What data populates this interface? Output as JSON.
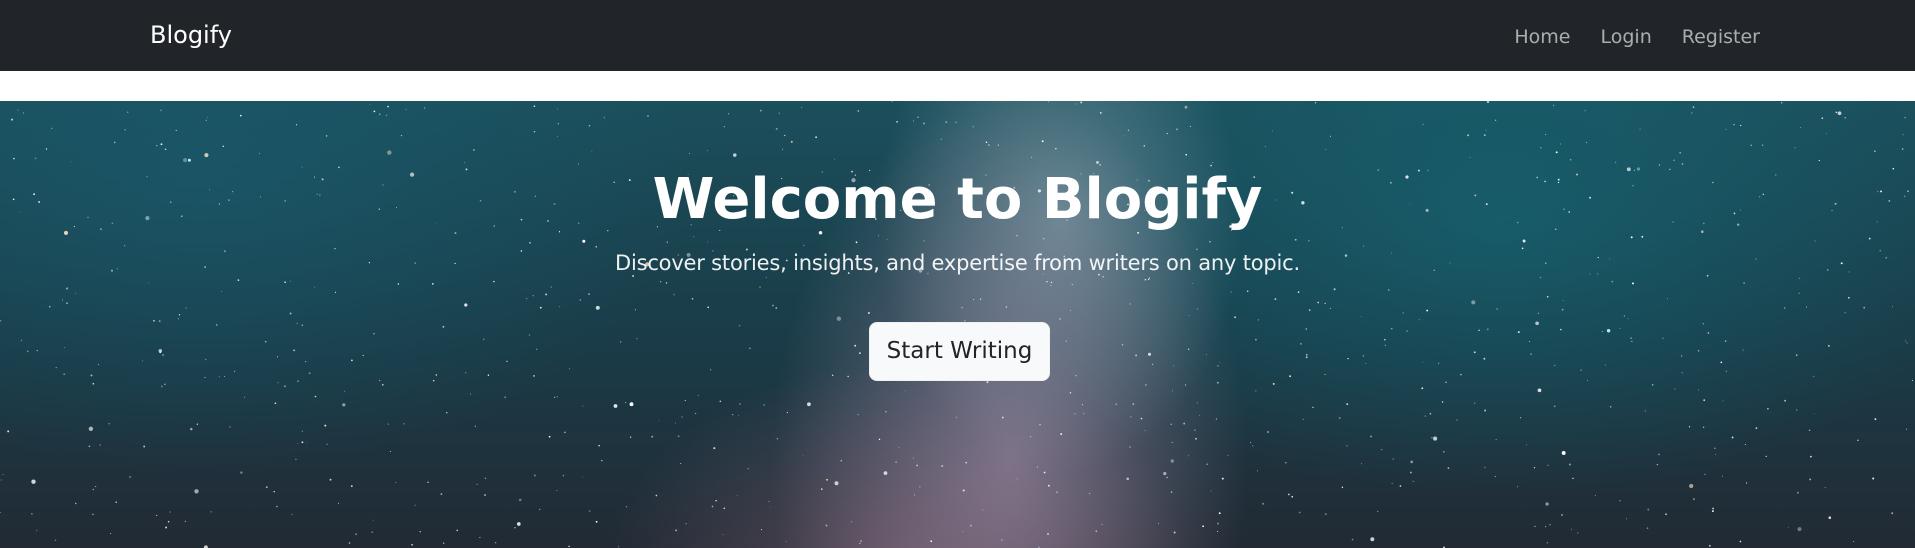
{
  "navbar": {
    "brand": "Blogify",
    "links": [
      "Home",
      "Login",
      "Register"
    ]
  },
  "hero": {
    "title": "Welcome to Blogify",
    "subtitle": "Discover stories, insights, and expertise from writers on any topic.",
    "cta_label": "Start Writing",
    "background": "starry-night-sky-image"
  },
  "colors": {
    "navbar_bg": "#212529",
    "button_bg": "#f8f9fa",
    "nav_link": "rgba(255,255,255,0.62)",
    "hero_text": "#ffffff"
  }
}
